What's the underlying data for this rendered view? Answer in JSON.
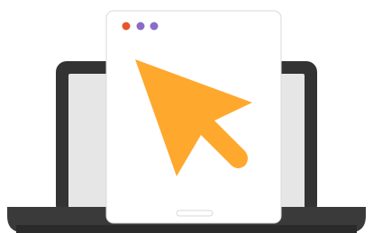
{
  "colors": {
    "background": "#ffffff",
    "laptop_frame": "#333333",
    "laptop_screen": "#e6e6e6",
    "laptop_base": "#3a3a3a",
    "laptop_base_shadow": "#2a2a2a",
    "window_bg": "#ffffff",
    "window_border": "#d9d9d9",
    "dot_1": "#e4572e",
    "dot_2": "#8c6bc7",
    "dot_3": "#8c6bc7",
    "cursor": "#ffa82e"
  },
  "icons": {
    "illustration": "laptop-with-browser-window-icon",
    "cursor": "mouse-pointer-arrow-icon"
  }
}
